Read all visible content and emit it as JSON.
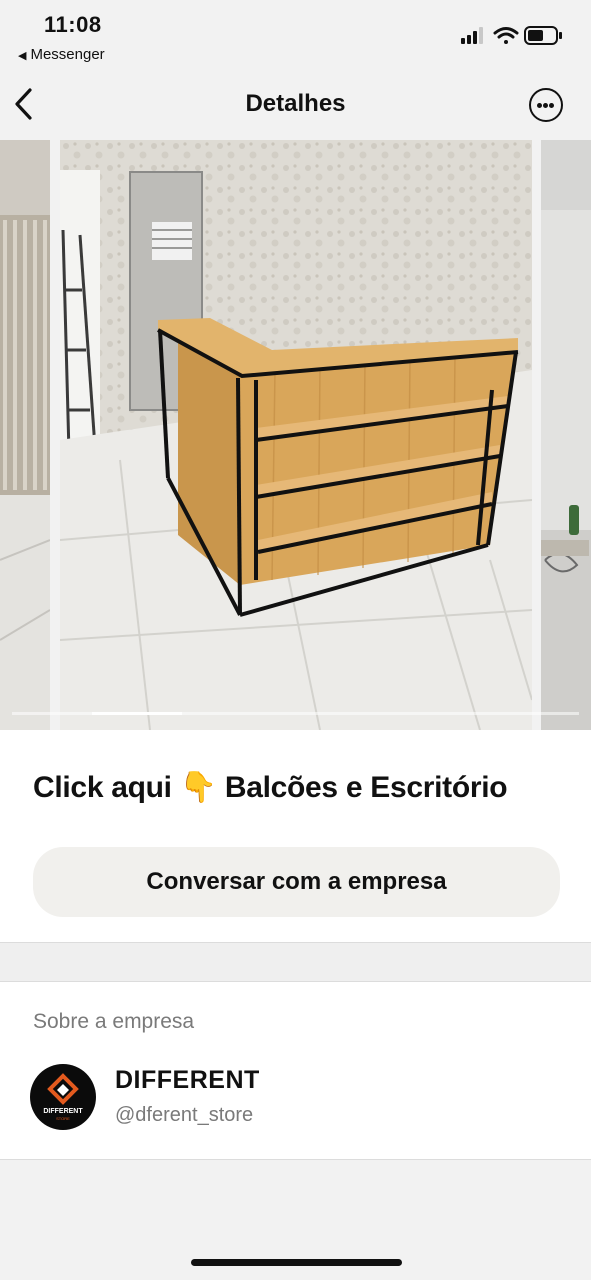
{
  "status_bar": {
    "time": "11:08",
    "back_app": "Messenger",
    "icons": [
      "signal-icon",
      "wifi-icon",
      "battery-icon"
    ]
  },
  "nav": {
    "title": "Detalhes",
    "back_icon": "chevron-left-icon",
    "more_icon": "more-options-icon"
  },
  "carousel": {
    "images": [
      "wooden-counter-left-edge-photo",
      "wooden-reception-counter-photo",
      "wooden-counter-right-edge-photo"
    ],
    "current_index": 1,
    "progress_fraction": 0.16
  },
  "product": {
    "title": "Click aqui 👇 Balcões e  Escritório",
    "chat_button_label": "Conversar com a empresa"
  },
  "about": {
    "heading": "Sobre a empresa",
    "company_name": "DIFFERENT",
    "company_handle": "@dferent_store",
    "logo_text": "DIFFERENT"
  },
  "colors": {
    "background": "#f2f2f2",
    "panel": "#ffffff",
    "button_bg": "#f1f0ed",
    "secondary_text": "#7a7a7a",
    "logo_accent": "#e35a1e"
  }
}
